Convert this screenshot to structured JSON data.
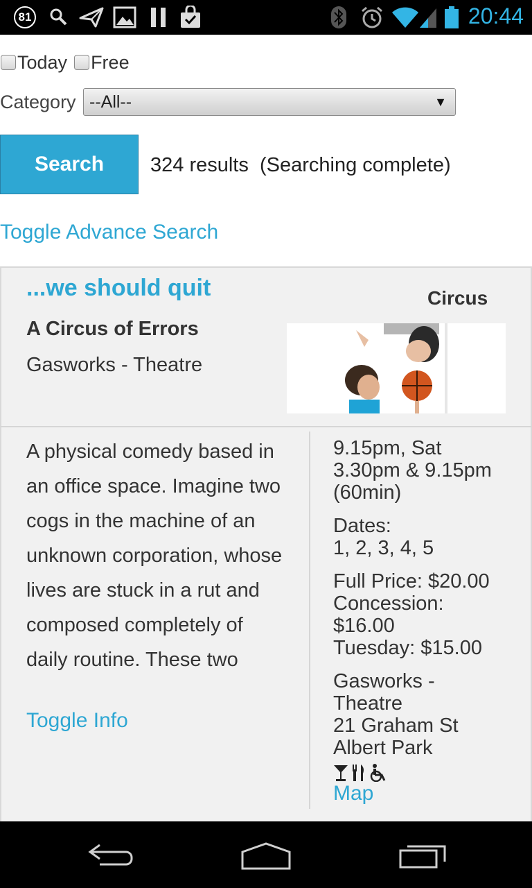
{
  "status_bar": {
    "notification_count": "81",
    "time": "20:44",
    "left_icons": [
      "search-icon",
      "send-icon",
      "image-icon",
      "pause-icon",
      "shopping-bag-icon"
    ],
    "right_icons": [
      "bluetooth-icon",
      "alarm-icon",
      "wifi-icon",
      "signal-icon",
      "battery-icon"
    ]
  },
  "filters": {
    "today_label": "Today",
    "free_label": "Free",
    "category_label": "Category",
    "category_selected": "--All--"
  },
  "search": {
    "button_label": "Search",
    "results_text": "324 results  (Searching complete)",
    "toggle_advance_label": "Toggle Advance Search"
  },
  "event": {
    "title": "...we should quit",
    "category": "Circus",
    "subtitle": "A Circus of Errors",
    "venue": "Gasworks - Theatre",
    "description": "A physical comedy based in an office space. Imagine two cogs in the machine of an unknown corporation, whose lives are stuck in a rut and composed completely of daily routine. These two",
    "toggle_info_label": "Toggle Info",
    "times": [
      "9.15pm, Sat",
      "3.30pm & 9.15pm",
      "(60min)"
    ],
    "dates": [
      "Dates:",
      "1, 2, 3, 4, 5"
    ],
    "prices": [
      "Full Price: $20.00",
      "Concession:",
      "$16.00",
      "Tuesday: $15.00"
    ],
    "address": [
      "Gasworks -",
      "Theatre",
      "21 Graham St",
      "Albert Park"
    ],
    "amenity_icons": [
      "bar-icon",
      "food-icon",
      "wheelchair-icon"
    ],
    "map_label": "Map"
  },
  "nav_bar": {
    "icons": [
      "back-icon",
      "home-icon",
      "recent-apps-icon"
    ]
  },
  "colors": {
    "accent": "#2ea7d3",
    "clock": "#33b5e5",
    "card_bg": "#f1f1f1"
  }
}
